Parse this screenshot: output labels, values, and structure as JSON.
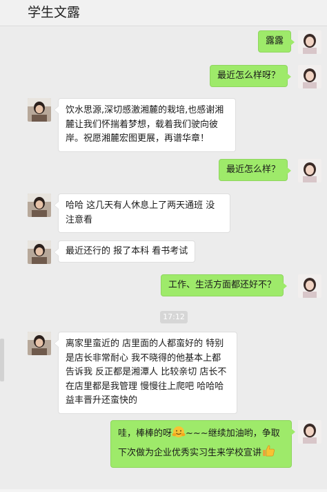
{
  "header": {
    "title": "学生文露"
  },
  "time_divider": "17:12",
  "messages": [
    {
      "sender": "me",
      "text": "露露"
    },
    {
      "sender": "me",
      "text": "最近怎么样呀？"
    },
    {
      "sender": "them",
      "text": "饮水思源,深切感激湘麓的栽培,也感谢湘麓让我们怀揣着梦想，载着我们驶向彼岸。祝愿湘麓宏图更展，再谱华章！"
    },
    {
      "sender": "me",
      "text": "最近怎么样？"
    },
    {
      "sender": "them",
      "text": "哈哈 这几天有人休息上了两天通班 没注意看"
    },
    {
      "sender": "them",
      "text": "最近还行的 报了本科 看书考试"
    },
    {
      "sender": "me",
      "text": "工作、生活方面都还好不？"
    },
    {
      "sender": "them",
      "text": "离家里蛮近的 店里面的人都蛮好的  特别是店长非常耐心 我不晓得的他基本上都告诉我 反正都是湘潭人  比较亲切 店长不在店里都是我管理 慢慢往上爬吧 哈哈哈 益丰晋升还蛮快的"
    },
    {
      "sender": "me",
      "text_a": "哇，棒棒的呀",
      "text_b": "~~~继续加油哟，争取下次做为企业优秀实习生来学校宣讲",
      "emoji_a": "hugging-face-emoji",
      "emoji_b": "thumbs-up-emoji"
    }
  ],
  "colors": {
    "my_bubble": "#9eea6a",
    "their_bubble": "#ffffff",
    "background": "#ececec"
  }
}
